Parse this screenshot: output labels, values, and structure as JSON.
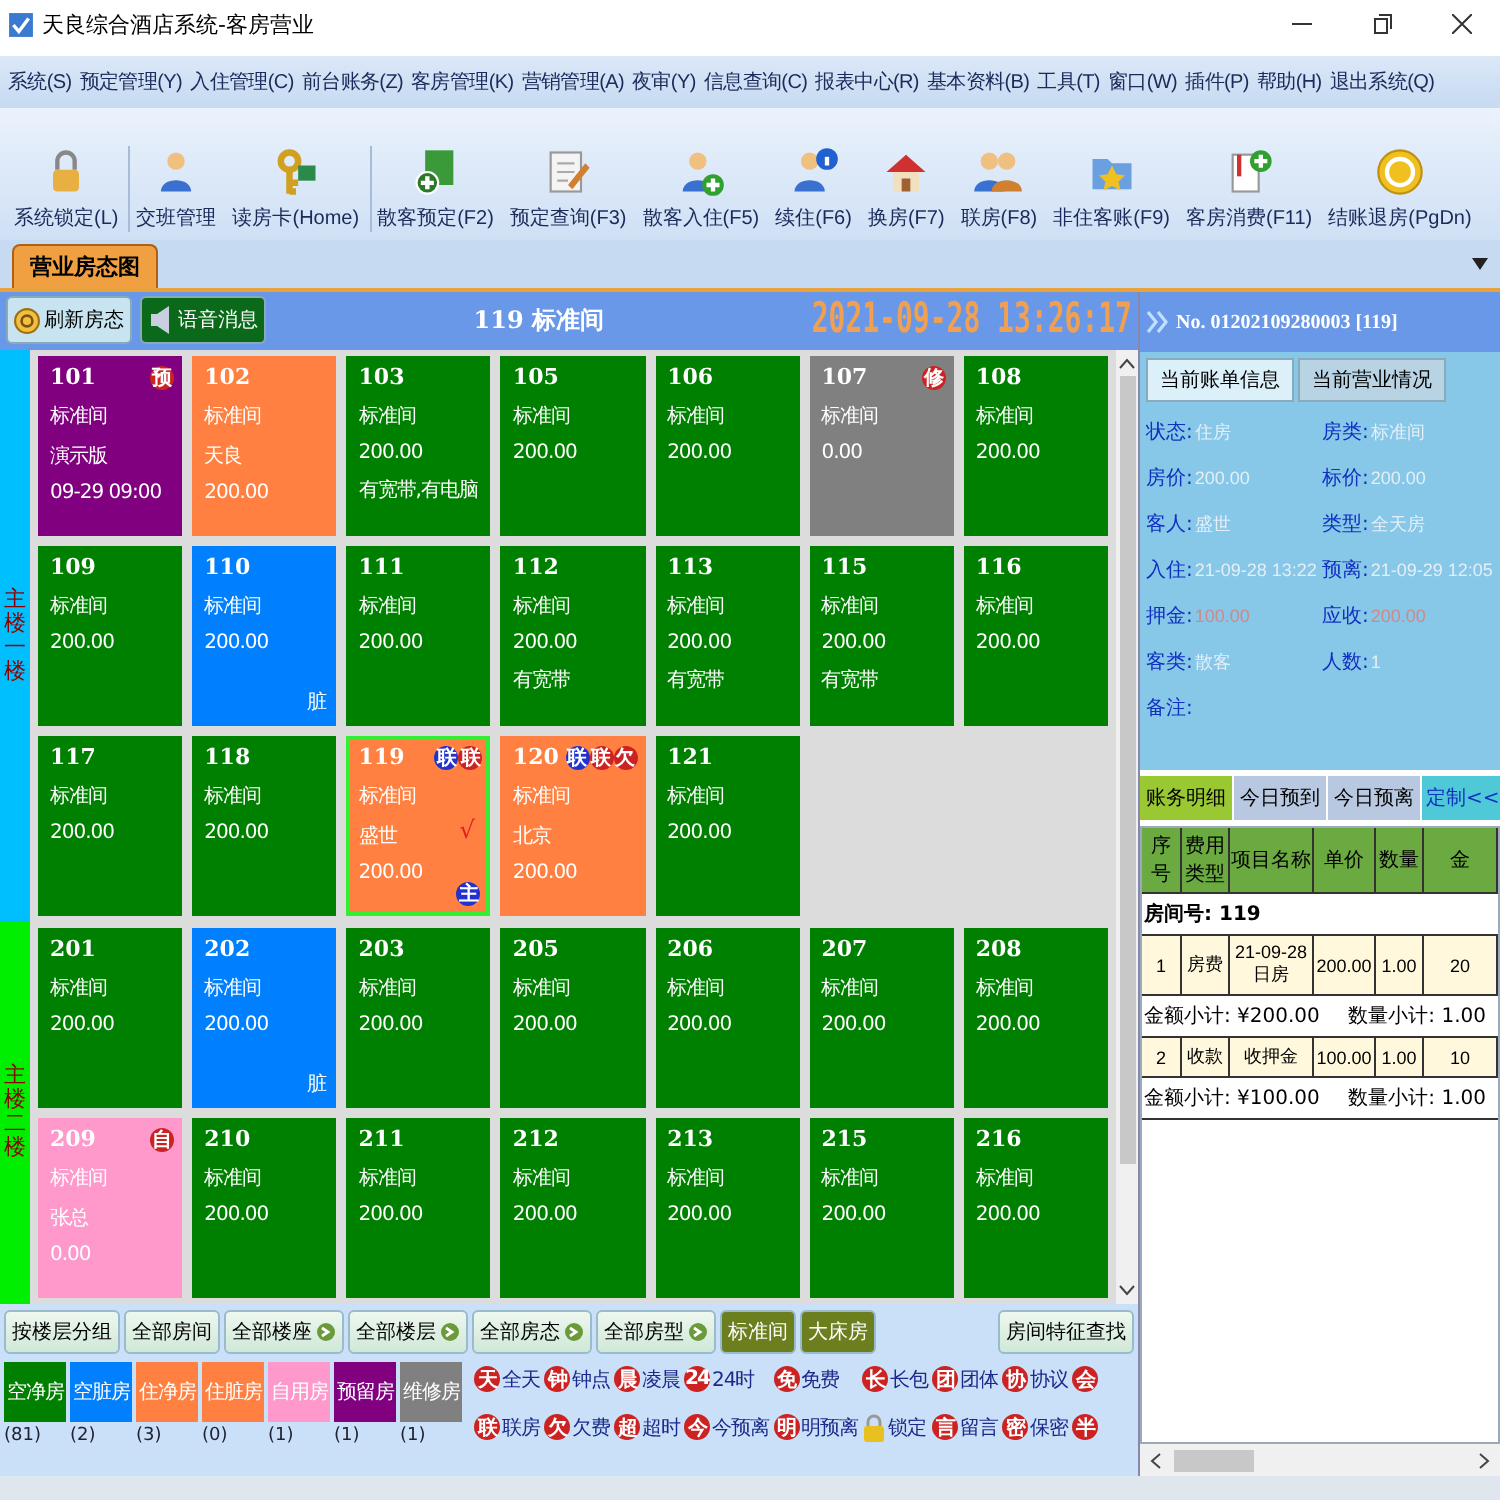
{
  "window": {
    "title": "天良综合酒店系统-客房营业"
  },
  "menu": [
    "系统(S)",
    "预定管理(Y)",
    "入住管理(C)",
    "前台账务(Z)",
    "客房管理(K)",
    "营销管理(A)",
    "夜审(Y)",
    "信息查询(C)",
    "报表中心(R)",
    "基本资料(B)",
    "工具(T)",
    "窗口(W)",
    "插件(P)",
    "帮助(H)",
    "退出系统(Q)"
  ],
  "toolbar": [
    "系统锁定(L)",
    "交班管理",
    "读房卡(Home)",
    "散客预定(F2)",
    "预定查询(F3)",
    "散客入住(F5)",
    "续住(F6)",
    "换房(F7)",
    "联房(F8)",
    "非住客账(F9)",
    "客房消费(F11)",
    "结账退房(PgDn)"
  ],
  "tabs": [
    {
      "label": "营业房态图",
      "selected": true
    }
  ],
  "header": {
    "buttons": [
      "刷新房态",
      "语音消息"
    ],
    "title": "119 标准间",
    "clock": "2021-09-28 13:26:17",
    "bill_no": "No. 01202109280003 [119]"
  },
  "floors": [
    {
      "label": "主楼一楼",
      "color": "#00bfff",
      "rooms": [
        {
          "number": "101",
          "type": "标准间",
          "lines": [
            "演示版",
            "09-29 09:00"
          ],
          "color": "#800080",
          "selected": false,
          "badges": [
            {
              "label": "预",
              "color": "#cc2222"
            }
          ]
        },
        {
          "number": "102",
          "type": "标准间",
          "lines": [
            "天良",
            "200.00"
          ],
          "color": "#ff8040",
          "selected": false
        },
        {
          "number": "103",
          "type": "标准间",
          "lines": [
            "200.00",
            "有宽带,有电脑"
          ],
          "color": "#008000",
          "selected": false
        },
        {
          "number": "105",
          "type": "标准间",
          "lines": [
            "200.00"
          ],
          "color": "#008000",
          "selected": false
        },
        {
          "number": "106",
          "type": "标准间",
          "lines": [
            "200.00"
          ],
          "color": "#008000",
          "selected": false
        },
        {
          "number": "107",
          "type": "标准间",
          "lines": [
            "0.00"
          ],
          "color": "#808080",
          "selected": false,
          "badges": [
            {
              "label": "修",
              "color": "#cc2222"
            }
          ]
        },
        {
          "number": "108",
          "type": "标准间",
          "lines": [
            "200.00"
          ],
          "color": "#008000",
          "selected": false
        },
        {
          "number": "109",
          "type": "标准间",
          "lines": [
            "200.00"
          ],
          "color": "#008000",
          "selected": false
        },
        {
          "number": "110",
          "type": "标准间",
          "lines": [
            "200.00"
          ],
          "color": "#0080ff",
          "selected": false,
          "corner": {
            "kind": "text",
            "label": "脏"
          }
        },
        {
          "number": "111",
          "type": "标准间",
          "lines": [
            "200.00"
          ],
          "color": "#008000",
          "selected": false
        },
        {
          "number": "112",
          "type": "标准间",
          "lines": [
            "200.00",
            "有宽带"
          ],
          "color": "#008000",
          "selected": false
        },
        {
          "number": "113",
          "type": "标准间",
          "lines": [
            "200.00",
            "有宽带"
          ],
          "color": "#008000",
          "selected": false
        },
        {
          "number": "115",
          "type": "标准间",
          "lines": [
            "200.00",
            "有宽带"
          ],
          "color": "#008000",
          "selected": false
        },
        {
          "number": "116",
          "type": "标准间",
          "lines": [
            "200.00"
          ],
          "color": "#008000",
          "selected": false
        },
        {
          "number": "117",
          "type": "标准间",
          "lines": [
            "200.00"
          ],
          "color": "#008000",
          "selected": false
        },
        {
          "number": "118",
          "type": "标准间",
          "lines": [
            "200.00"
          ],
          "color": "#008000",
          "selected": false
        },
        {
          "number": "119",
          "type": "标准间",
          "lines": [
            "盛世",
            "200.00"
          ],
          "color": "#ff8040",
          "selected": true,
          "badges": [
            {
              "label": "联",
              "color": "#2233cc"
            },
            {
              "label": "联",
              "color": "#cc2222"
            }
          ],
          "check": "√",
          "corner": {
            "kind": "badge",
            "label": "主",
            "color": "#2233cc"
          }
        },
        {
          "number": "120",
          "type": "标准间",
          "lines": [
            "北京",
            "200.00"
          ],
          "color": "#ff8040",
          "selected": false,
          "badges": [
            {
              "label": "联",
              "color": "#2233cc"
            },
            {
              "label": "联",
              "color": "#cc2222"
            },
            {
              "label": "欠",
              "color": "#cc2222"
            }
          ]
        },
        {
          "number": "121",
          "type": "标准间",
          "lines": [
            "200.00"
          ],
          "color": "#008000",
          "selected": false
        }
      ]
    },
    {
      "label": "主楼二楼",
      "color": "#00ee00",
      "rooms": [
        {
          "number": "201",
          "type": "标准间",
          "lines": [
            "200.00"
          ],
          "color": "#008000",
          "selected": false
        },
        {
          "number": "202",
          "type": "标准间",
          "lines": [
            "200.00"
          ],
          "color": "#0080ff",
          "selected": false,
          "corner": {
            "kind": "text",
            "label": "脏"
          }
        },
        {
          "number": "203",
          "type": "标准间",
          "lines": [
            "200.00"
          ],
          "color": "#008000",
          "selected": false
        },
        {
          "number": "205",
          "type": "标准间",
          "lines": [
            "200.00"
          ],
          "color": "#008000",
          "selected": false
        },
        {
          "number": "206",
          "type": "标准间",
          "lines": [
            "200.00"
          ],
          "color": "#008000",
          "selected": false
        },
        {
          "number": "207",
          "type": "标准间",
          "lines": [
            "200.00"
          ],
          "color": "#008000",
          "selected": false
        },
        {
          "number": "208",
          "type": "标准间",
          "lines": [
            "200.00"
          ],
          "color": "#008000",
          "selected": false
        },
        {
          "number": "209",
          "type": "标准间",
          "lines": [
            "张总",
            "0.00"
          ],
          "color": "#ff99cc",
          "selected": false,
          "badges": [
            {
              "label": "自",
              "color": "#cc2222"
            }
          ]
        },
        {
          "number": "210",
          "type": "标准间",
          "lines": [
            "200.00"
          ],
          "color": "#008000",
          "selected": false
        },
        {
          "number": "211",
          "type": "标准间",
          "lines": [
            "200.00"
          ],
          "color": "#008000",
          "selected": false
        },
        {
          "number": "212",
          "type": "标准间",
          "lines": [
            "200.00"
          ],
          "color": "#008000",
          "selected": false
        },
        {
          "number": "213",
          "type": "标准间",
          "lines": [
            "200.00"
          ],
          "color": "#008000",
          "selected": false
        },
        {
          "number": "215",
          "type": "标准间",
          "lines": [
            "200.00"
          ],
          "color": "#008000",
          "selected": false
        },
        {
          "number": "216",
          "type": "标准间",
          "lines": [
            "200.00"
          ],
          "color": "#008000",
          "selected": false
        }
      ]
    }
  ],
  "bottom": {
    "filters": [
      {
        "label": "按楼层分组",
        "kind": "plain"
      },
      {
        "label": "全部房间",
        "kind": "plain"
      },
      {
        "label": "全部楼座",
        "kind": "dropdown"
      },
      {
        "label": "全部楼层",
        "kind": "dropdown"
      },
      {
        "label": "全部房态",
        "kind": "dropdown"
      },
      {
        "label": "全部房型",
        "kind": "dropdown"
      },
      {
        "label": "标准间",
        "kind": "type"
      },
      {
        "label": "大床房",
        "kind": "type"
      }
    ],
    "feature_search": "房间特征查找",
    "statuses": [
      {
        "label": "空净房",
        "count": "(81)",
        "color": "#008000"
      },
      {
        "label": "空脏房",
        "count": "(2)",
        "color": "#0080ff"
      },
      {
        "label": "住净房",
        "count": "(3)",
        "color": "#ff8040"
      },
      {
        "label": "住脏房",
        "count": "(0)",
        "color": "#ff8040"
      },
      {
        "label": "自用房",
        "count": "(1)",
        "color": "#ff99cc"
      },
      {
        "label": "预留房",
        "count": "(1)",
        "color": "#800080"
      },
      {
        "label": "维修房",
        "count": "(1)",
        "color": "#808080"
      }
    ],
    "marker_rows": [
      [
        {
          "kind": "char",
          "icon": "天",
          "label": "全天"
        },
        {
          "kind": "char",
          "icon": "钟",
          "label": "钟点"
        },
        {
          "kind": "char",
          "icon": "晨",
          "label": "凌晨"
        },
        {
          "kind": "char",
          "icon": "24",
          "label": "24时"
        },
        {
          "kind": "char",
          "icon": "免",
          "label": "免费"
        },
        {
          "kind": "char",
          "icon": "长",
          "label": "长包"
        },
        {
          "kind": "char",
          "icon": "团",
          "label": "团体"
        },
        {
          "kind": "char",
          "icon": "协",
          "label": "协议"
        },
        {
          "kind": "char",
          "icon": "会"
        }
      ],
      [
        {
          "kind": "char",
          "icon": "联",
          "label": "联房"
        },
        {
          "kind": "char",
          "icon": "欠",
          "label": "欠费"
        },
        {
          "kind": "char",
          "icon": "超",
          "label": "超时"
        },
        {
          "kind": "char",
          "icon": "今",
          "label": "今预离"
        },
        {
          "kind": "char",
          "icon": "明",
          "label": "明预离"
        },
        {
          "kind": "lock",
          "label": "锁定"
        },
        {
          "kind": "char",
          "icon": "言",
          "label": "留言"
        },
        {
          "kind": "char",
          "icon": "密",
          "label": "保密"
        },
        {
          "kind": "char",
          "icon": "半"
        }
      ]
    ]
  },
  "info": {
    "tabs": [
      {
        "label": "当前账单信息",
        "selected": true
      },
      {
        "label": "当前营业情况",
        "selected": false
      }
    ],
    "fields": [
      {
        "label": "状态:",
        "value": "住房",
        "color": "#e4eef8"
      },
      {
        "label": "房类:",
        "value": "标准间",
        "color": "#e4eef8"
      },
      {
        "label": "房价:",
        "value": "200.00",
        "color": "#e4eef8"
      },
      {
        "label": "标价:",
        "value": "200.00",
        "color": "#e4eef8"
      },
      {
        "label": "客人:",
        "value": "盛世",
        "color": "#e4eef8"
      },
      {
        "label": "类型:",
        "value": "全天房",
        "color": "#e4eef8"
      },
      {
        "label": "入住:",
        "value": "21-09-28 13:22",
        "color": "#e4eef8"
      },
      {
        "label": "预离:",
        "value": "21-09-29 12:05",
        "color": "#e4eef8"
      },
      {
        "label": "押金:",
        "value": "100.00",
        "color": "#d08888"
      },
      {
        "label": "应收:",
        "value": "200.00",
        "color": "#d08888"
      },
      {
        "label": "客类:",
        "value": "散客",
        "color": "#e4eef8"
      },
      {
        "label": "人数:",
        "value": "1",
        "color": "#e4eef8"
      },
      {
        "label": "备注:"
      }
    ]
  },
  "billing": {
    "tabs": [
      {
        "label": "账务明细",
        "selected": true
      },
      {
        "label": "今日预到",
        "selected": false
      },
      {
        "label": "今日预离",
        "selected": false
      }
    ],
    "customize_button": "定制<<",
    "columns": [
      "序号",
      "费用类型",
      "项目名称",
      "单价",
      "数量",
      "金"
    ],
    "rows": [
      {
        "kind": "group",
        "label": "房间号: 119"
      },
      {
        "kind": "item",
        "cells": [
          "1",
          "房费",
          "21-09-28日房",
          "200.00",
          "1.00",
          "20"
        ]
      },
      {
        "kind": "subtotal",
        "amount": "金额小计: ¥200.00",
        "quantity": "数量小计: 1.00"
      },
      {
        "kind": "item",
        "cells": [
          "2",
          "收款",
          "收押金",
          "100.00",
          "1.00",
          "10"
        ]
      },
      {
        "kind": "subtotal",
        "amount": "金额小计: ¥100.00",
        "quantity": "数量小计: 1.00"
      }
    ]
  }
}
